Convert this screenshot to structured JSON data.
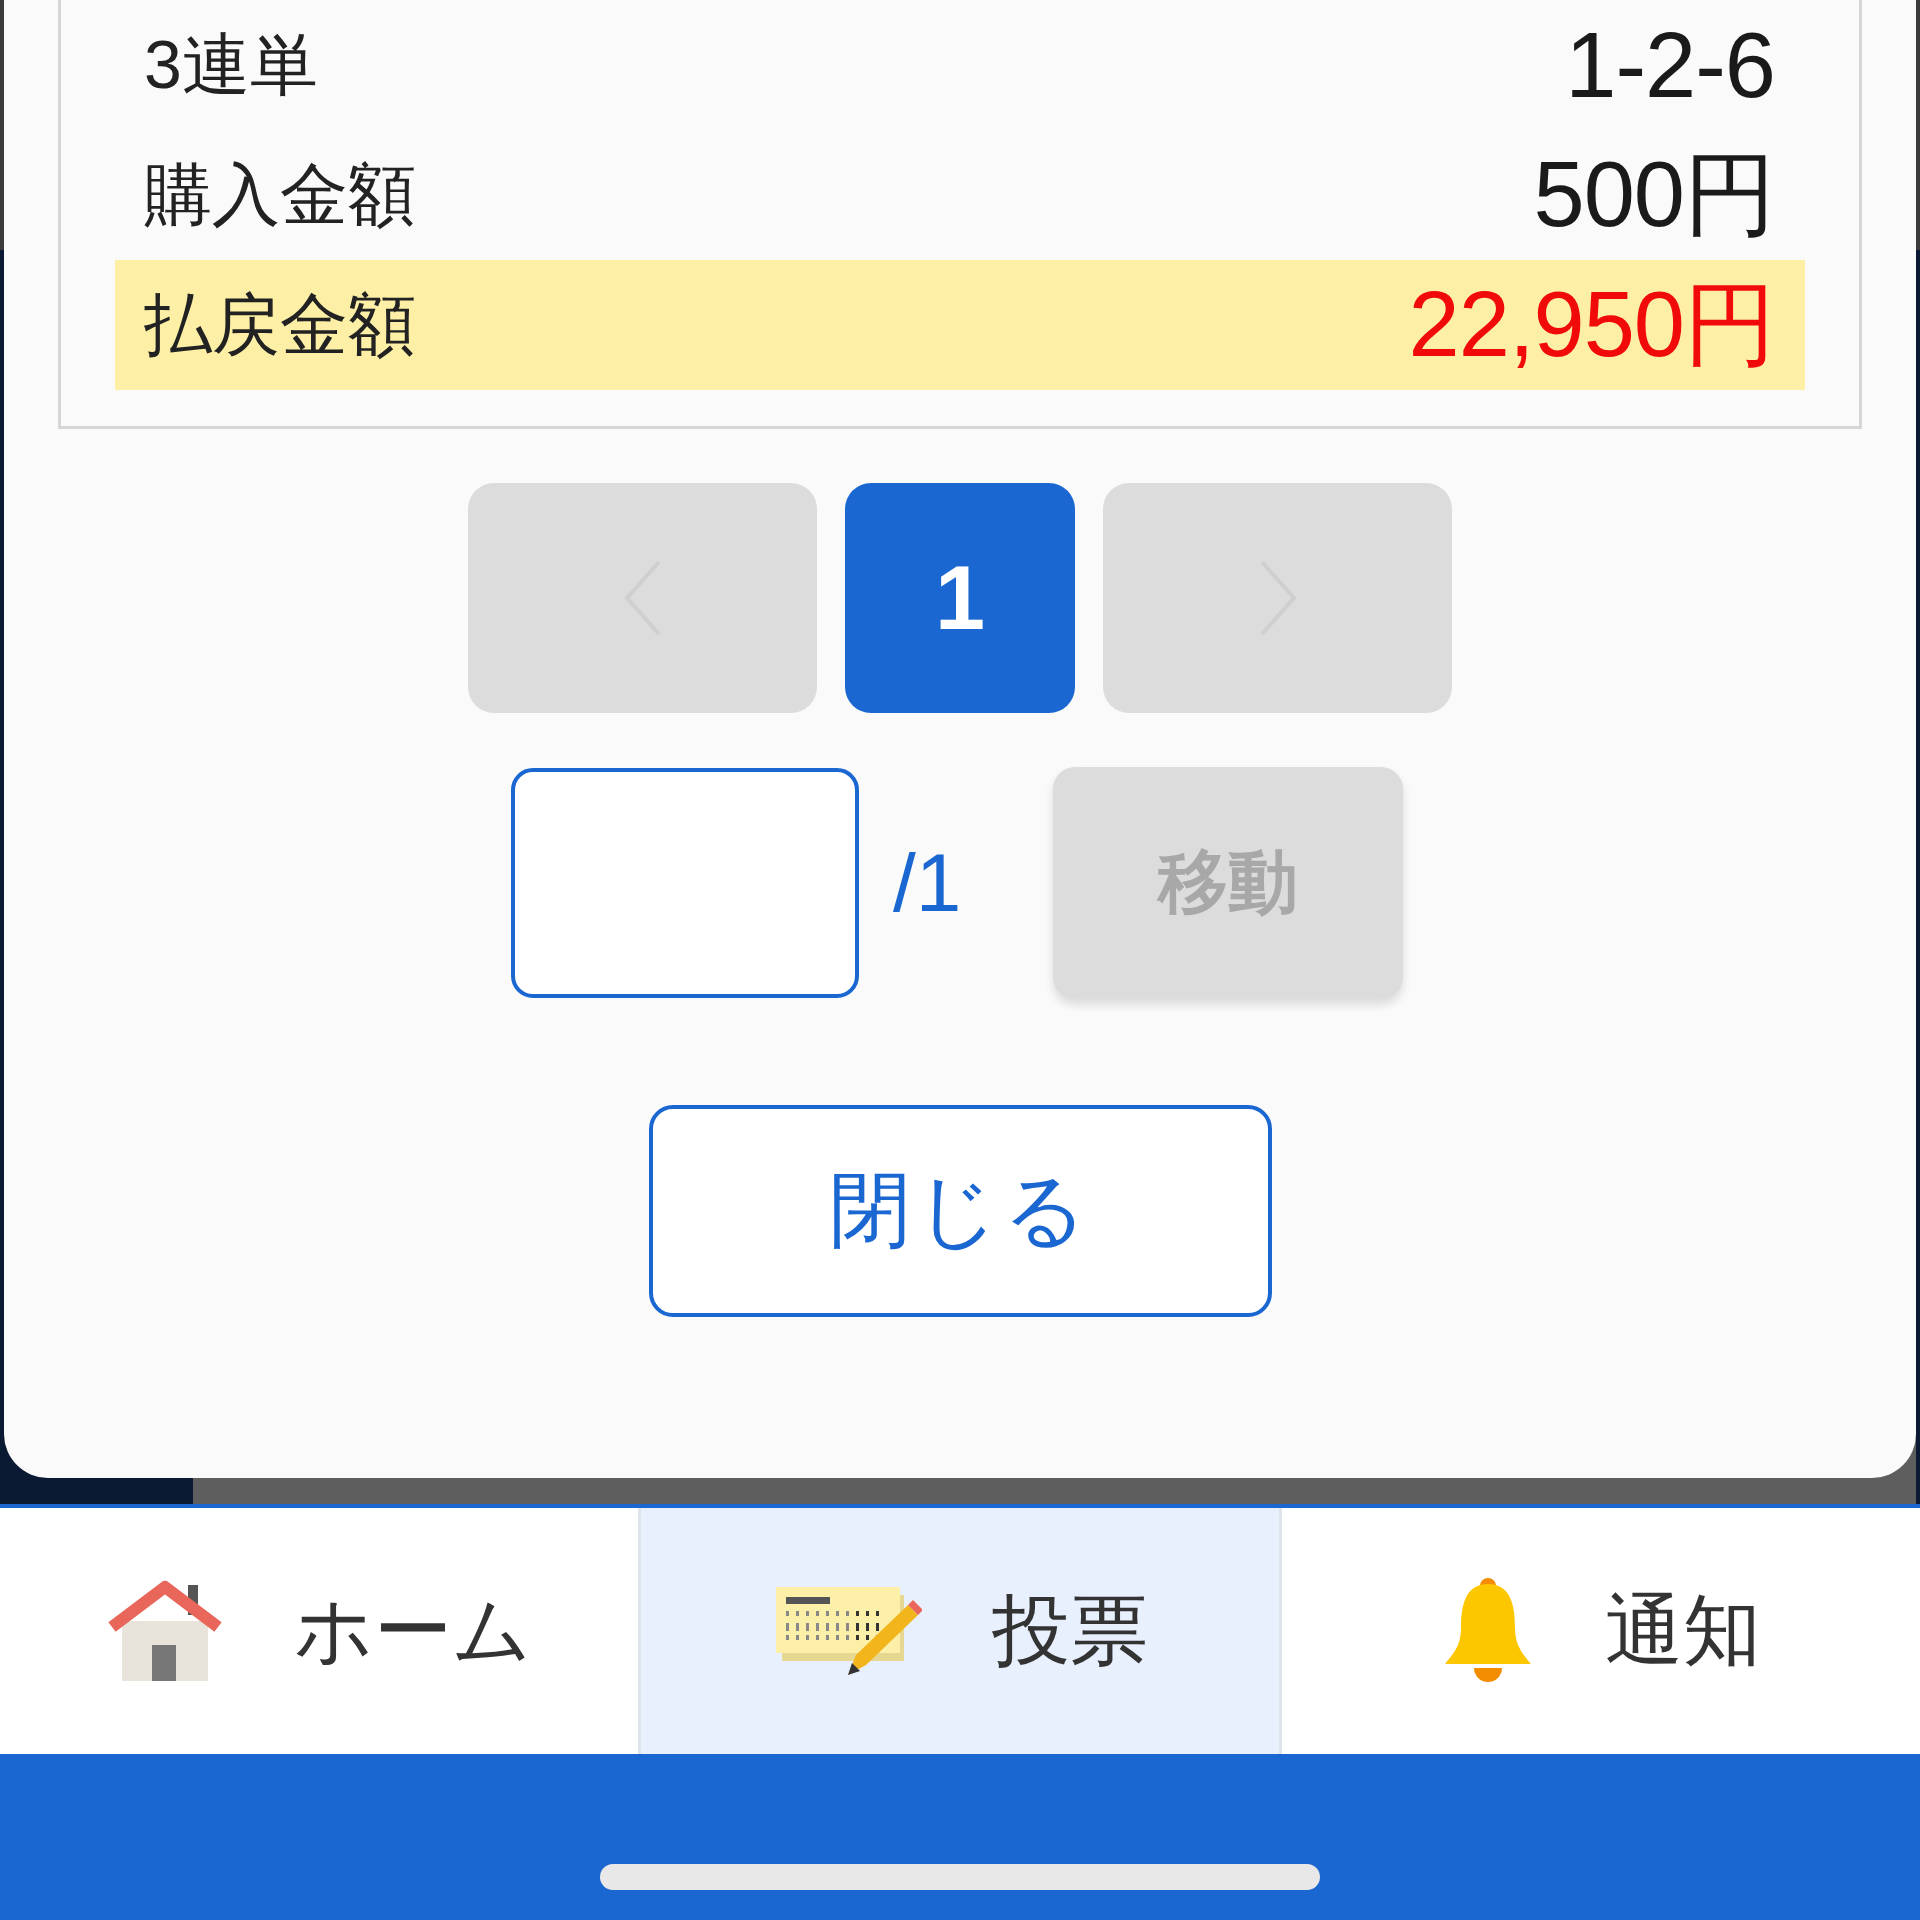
{
  "result_rows": [
    {
      "label": "3連単",
      "value": "1-2-6",
      "highlighted": false
    },
    {
      "label": "購入金額",
      "value": "500円",
      "highlighted": false
    },
    {
      "label": "払戻金額",
      "value": "22,950円",
      "highlighted": true
    }
  ],
  "pager": {
    "prev": {
      "disabled": true
    },
    "pages": [
      {
        "label": "1",
        "selected": true
      }
    ],
    "next": {
      "disabled": true
    }
  },
  "page_jump": {
    "total": "/1",
    "button": {
      "label": "移動",
      "disabled": true
    }
  },
  "close_button": "閉じる",
  "nav": [
    {
      "kind": "home",
      "label": "ホーム",
      "selected": false
    },
    {
      "kind": "vote",
      "label": "投票",
      "selected": true
    },
    {
      "kind": "notice",
      "label": "通知",
      "selected": false
    }
  ]
}
